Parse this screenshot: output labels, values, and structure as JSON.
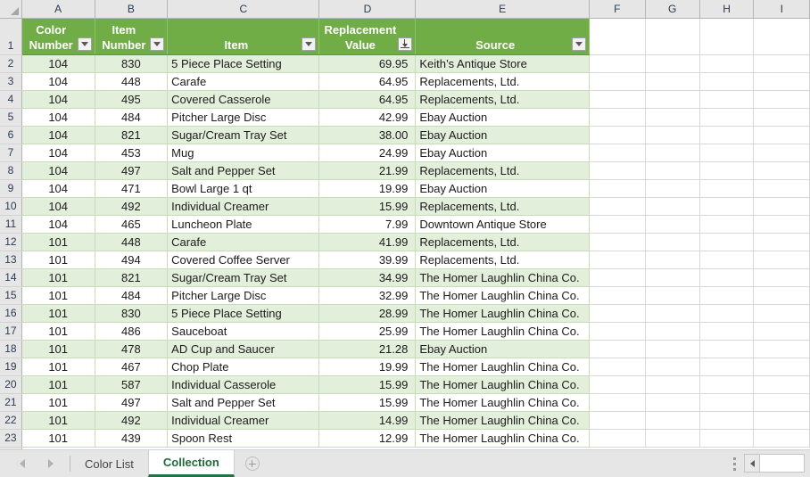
{
  "grid": {
    "column_letters": [
      "A",
      "B",
      "C",
      "D",
      "E",
      "F",
      "G",
      "H",
      "I"
    ],
    "select_all_icon": "select-all-corner-icon",
    "row_numbers": [
      "1",
      "2",
      "3",
      "4",
      "5",
      "6",
      "7",
      "8",
      "9",
      "10",
      "11",
      "12",
      "13",
      "14",
      "15",
      "16",
      "17",
      "18",
      "19",
      "20",
      "21",
      "22",
      "23"
    ]
  },
  "table": {
    "header_fill": "#70AD47",
    "band_fill": "#E2EFDA",
    "headers": [
      {
        "line1": "Color",
        "line2": "Number",
        "filter": "dropdown"
      },
      {
        "line1": "Item",
        "line2": "Number",
        "filter": "dropdown"
      },
      {
        "line1": "",
        "line2": "Item",
        "filter": "dropdown"
      },
      {
        "line1": "Replacement",
        "line2": "Value",
        "filter": "sorted-descending"
      },
      {
        "line1": "",
        "line2": "Source",
        "filter": "dropdown"
      }
    ],
    "rows": [
      {
        "row": "2",
        "color_number": "104",
        "item_number": "830",
        "item": "5 Piece Place Setting",
        "replacement_value": "69.95",
        "source": "Keith’s Antique Store"
      },
      {
        "row": "3",
        "color_number": "104",
        "item_number": "448",
        "item": "Carafe",
        "replacement_value": "64.95",
        "source": "Replacements, Ltd."
      },
      {
        "row": "4",
        "color_number": "104",
        "item_number": "495",
        "item": "Covered Casserole",
        "replacement_value": "64.95",
        "source": "Replacements, Ltd."
      },
      {
        "row": "5",
        "color_number": "104",
        "item_number": "484",
        "item": "Pitcher Large Disc",
        "replacement_value": "42.99",
        "source": "Ebay Auction"
      },
      {
        "row": "6",
        "color_number": "104",
        "item_number": "821",
        "item": "Sugar/Cream Tray Set",
        "replacement_value": "38.00",
        "source": "Ebay Auction"
      },
      {
        "row": "7",
        "color_number": "104",
        "item_number": "453",
        "item": "Mug",
        "replacement_value": "24.99",
        "source": "Ebay Auction"
      },
      {
        "row": "8",
        "color_number": "104",
        "item_number": "497",
        "item": "Salt and Pepper Set",
        "replacement_value": "21.99",
        "source": "Replacements, Ltd."
      },
      {
        "row": "9",
        "color_number": "104",
        "item_number": "471",
        "item": "Bowl Large 1 qt",
        "replacement_value": "19.99",
        "source": "Ebay Auction"
      },
      {
        "row": "10",
        "color_number": "104",
        "item_number": "492",
        "item": "Individual Creamer",
        "replacement_value": "15.99",
        "source": "Replacements, Ltd."
      },
      {
        "row": "11",
        "color_number": "104",
        "item_number": "465",
        "item": "Luncheon Plate",
        "replacement_value": "7.99",
        "source": "Downtown Antique Store"
      },
      {
        "row": "12",
        "color_number": "101",
        "item_number": "448",
        "item": "Carafe",
        "replacement_value": "41.99",
        "source": "Replacements, Ltd."
      },
      {
        "row": "13",
        "color_number": "101",
        "item_number": "494",
        "item": "Covered Coffee Server",
        "replacement_value": "39.99",
        "source": "Replacements, Ltd."
      },
      {
        "row": "14",
        "color_number": "101",
        "item_number": "821",
        "item": "Sugar/Cream Tray Set",
        "replacement_value": "34.99",
        "source": "The Homer Laughlin China Co."
      },
      {
        "row": "15",
        "color_number": "101",
        "item_number": "484",
        "item": "Pitcher Large Disc",
        "replacement_value": "32.99",
        "source": "The Homer Laughlin China Co."
      },
      {
        "row": "16",
        "color_number": "101",
        "item_number": "830",
        "item": "5 Piece Place Setting",
        "replacement_value": "28.99",
        "source": "The Homer Laughlin China Co."
      },
      {
        "row": "17",
        "color_number": "101",
        "item_number": "486",
        "item": "Sauceboat",
        "replacement_value": "25.99",
        "source": "The Homer Laughlin China Co."
      },
      {
        "row": "18",
        "color_number": "101",
        "item_number": "478",
        "item": "AD Cup and Saucer",
        "replacement_value": "21.28",
        "source": "Ebay Auction"
      },
      {
        "row": "19",
        "color_number": "101",
        "item_number": "467",
        "item": "Chop Plate",
        "replacement_value": "19.99",
        "source": "The Homer Laughlin China Co."
      },
      {
        "row": "20",
        "color_number": "101",
        "item_number": "587",
        "item": "Individual Casserole",
        "replacement_value": "15.99",
        "source": "The Homer Laughlin China Co."
      },
      {
        "row": "21",
        "color_number": "101",
        "item_number": "497",
        "item": "Salt and Pepper Set",
        "replacement_value": "15.99",
        "source": "The Homer Laughlin China Co."
      },
      {
        "row": "22",
        "color_number": "101",
        "item_number": "492",
        "item": "Individual Creamer",
        "replacement_value": "14.99",
        "source": "The Homer Laughlin China Co."
      },
      {
        "row": "23",
        "color_number": "101",
        "item_number": "439",
        "item": "Spoon Rest",
        "replacement_value": "12.99",
        "source": "The Homer Laughlin China Co."
      }
    ]
  },
  "tabbar": {
    "prev_icon": "previous-sheet-arrow-icon",
    "next_icon": "next-sheet-arrow-icon",
    "sheets": [
      {
        "label": "Color List",
        "active": false
      },
      {
        "label": "Collection",
        "active": true
      }
    ],
    "add_sheet_icon": "add-sheet-plus-icon",
    "grip_icon": "resize-grip-icon",
    "scroll_left_icon": "scroll-left-arrow-icon",
    "active_tab_color": "#217346"
  }
}
